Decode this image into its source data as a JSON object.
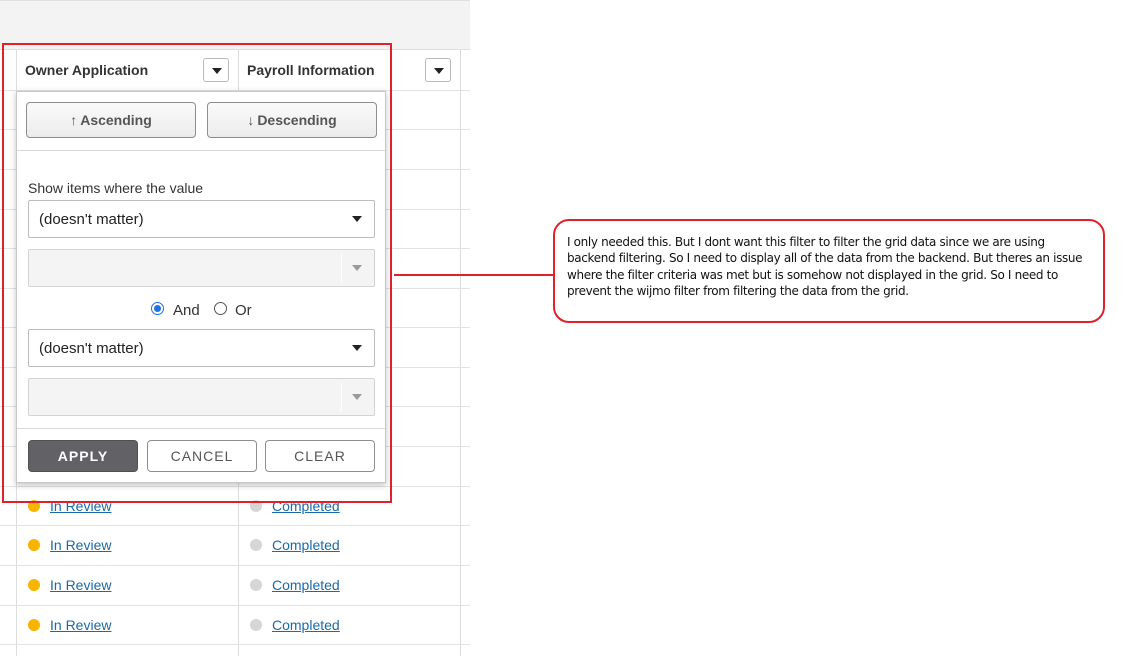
{
  "grid": {
    "columns": [
      {
        "label": "Owner Application"
      },
      {
        "label": "Payroll Information"
      }
    ],
    "rows": [
      {
        "owner_status": "In Review",
        "owner_color": "#f7b500",
        "payroll_status": "Completed",
        "payroll_color": "#d6d6d6"
      },
      {
        "owner_status": "In Review",
        "owner_color": "#f7b500",
        "payroll_status": "Completed",
        "payroll_color": "#d6d6d6"
      },
      {
        "owner_status": "In Review",
        "owner_color": "#f7b500",
        "payroll_status": "Completed",
        "payroll_color": "#d6d6d6"
      },
      {
        "owner_status": "In Review",
        "owner_color": "#f7b500",
        "payroll_status": "Completed",
        "payroll_color": "#d6d6d6"
      }
    ]
  },
  "filter": {
    "sort_ascending": "Ascending",
    "sort_ascending_icon": "↑",
    "sort_descending": "Descending",
    "sort_descending_icon": "↓",
    "caption": "Show items where the value",
    "condition1_operator": "(doesn't matter)",
    "condition1_value": "",
    "and_label": "And",
    "or_label": "Or",
    "and_selected": true,
    "condition2_operator": "(doesn't matter)",
    "condition2_value": "",
    "apply_label": "APPLY",
    "cancel_label": "CANCEL",
    "clear_label": "CLEAR"
  },
  "annotation": {
    "text": "I only needed this. But I dont want this filter to filter the grid data since we are using backend filtering. So I need to display all of the data from the backend. But theres an issue where the filter criteria was met but is somehow not displayed in the grid. So I need to prevent the wijmo filter from filtering the data from the grid.",
    "color": "#e0212b"
  }
}
